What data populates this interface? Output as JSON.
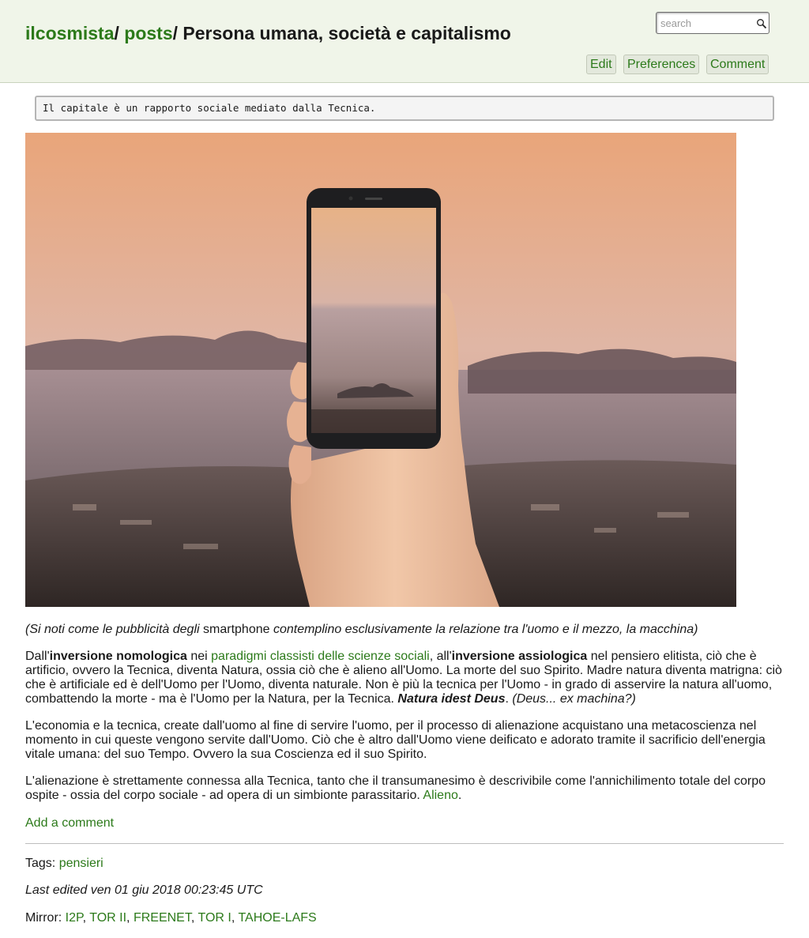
{
  "header": {
    "breadcrumb": [
      {
        "label": "ilcosmista"
      },
      {
        "label": "posts"
      }
    ],
    "separator": "/ ",
    "page_title": "Persona umana, società e capitalismo",
    "search": {
      "placeholder": "search",
      "value": ""
    },
    "actions": {
      "edit": "Edit",
      "preferences": "Preferences",
      "comment": "Comment"
    }
  },
  "quote": "Il capitale è un rapporto sociale mediato dalla Tecnica.",
  "caption": {
    "part1": "(Si noti come le pubblicità degli ",
    "part2": "smartphone",
    "part3": " contemplino esclusivamente la relazione tra l'uomo e il mezzo, la macchina)"
  },
  "paragraph1": {
    "t1": "Dall'",
    "b1": "inversione nomologica",
    "t2": " nei ",
    "link": "paradigmi classisti delle scienze sociali",
    "t3": ", all'",
    "b2": "inversione assiologica",
    "t4": " nel pensiero elitista, ciò che è artificio, ovvero la Tecnica, diventa Natura, ossia ciò che è alieno all'Uomo. La morte del suo Spirito. Madre natura diventa matrigna: ciò che è artificiale ed è dell'Uomo per l'Uomo, diventa naturale. Non è più la tecnica per l'Uomo - in grado di asservire la natura all'uomo, combattendo la morte - ma è l'Uomo per la Natura, per la Tecnica. ",
    "bi": "Natura idest Deus",
    "t5": ". ",
    "i1": "(Deus... ex machina?)"
  },
  "paragraph2": "L'economia e la tecnica, create dall'uomo al fine di servire l'uomo, per il processo di alienazione acquistano una metacoscienza nel momento in cui queste vengono servite dall'Uomo. Ciò che è altro dall'Uomo viene deificato e adorato tramite il sacrificio dell'energia vitale umana: del suo Tempo. Ovvero la sua Coscienza ed il suo Spirito.",
  "paragraph3": {
    "text": "L'alienazione è strettamente connessa alla Tecnica, tanto che il transumanesimo è descrivibile come l'annichilimento totale del corpo ospite - ossia del corpo sociale - ad opera di un simbionte parassitario. ",
    "link": "Alieno",
    "end": "."
  },
  "add_comment": "Add a comment",
  "tags": {
    "label": "Tags: ",
    "items": [
      "pensieri"
    ]
  },
  "last_edited": "Last edited ven 01 giu 2018 00:23:45 UTC",
  "mirror": {
    "label": "Mirror: ",
    "items": [
      "I2P",
      "TOR II",
      "FREENET",
      "TOR I",
      "TAHOE-LAFS"
    ],
    "separator": ", "
  },
  "colors": {
    "link": "#2c7a1a",
    "header_bg": "#f0f5e9",
    "button_bg": "#e3e8dc"
  }
}
